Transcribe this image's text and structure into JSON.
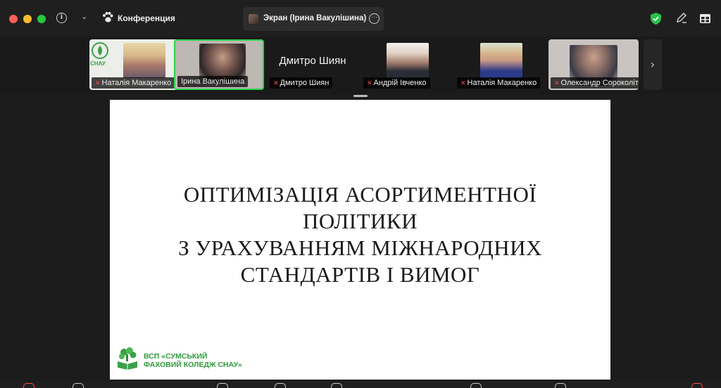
{
  "titlebar": {
    "conference_label": "Конференция",
    "screen_share_label": "Экран (Ірина Вакулішина)"
  },
  "participants": [
    {
      "name": "Наталія Макаренко",
      "muted": true
    },
    {
      "name": "Ірина Вакулішина",
      "muted": false,
      "active_speaker": true
    },
    {
      "name": "Дмитро Шиян",
      "muted": true,
      "video_off": true
    },
    {
      "name": "Андрій Івченко",
      "muted": true
    },
    {
      "name": "Наталія Макаренко",
      "muted": true
    },
    {
      "name": "Олександр Сороколіт",
      "muted": true
    }
  ],
  "video_off_display_name": "Дмитро Шиян",
  "first_tile_logo_text": "СНАУ",
  "slide": {
    "title_lines": [
      "ОПТИМІЗАЦІЯ АСОРТИМЕНТНОЇ",
      "ПОЛІТИКИ",
      "З УРАХУВАННЯМ МІЖНАРОДНИХ",
      "СТАНДАРТІВ І ВИМОГ"
    ],
    "college_line1": "ВСП «СУМСЬКИЙ",
    "college_line2": "ФАХОВИЙ КОЛЕДЖ СНАУ»"
  },
  "colors": {
    "active_speaker_border": "#2fd14f",
    "muted_icon": "#ff4b4b",
    "security_shield": "#27c24a",
    "college_green": "#2e9a3a"
  }
}
